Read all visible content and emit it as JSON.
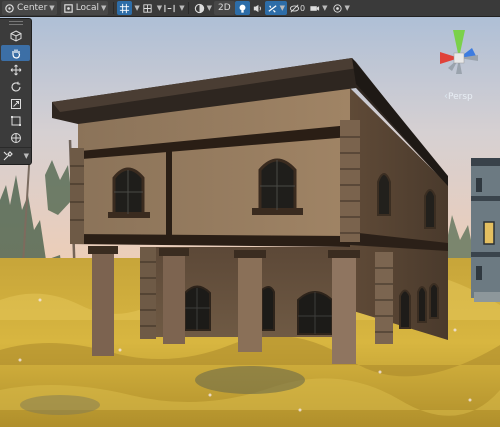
{
  "toolbar": {
    "pivot_label": "Center",
    "space_label": "Local",
    "mode_2d_label": "2D"
  },
  "gizmo": {
    "projection_label": "Persp"
  },
  "icons": {
    "pivot": "pivot-icon",
    "space": "local-space-icon",
    "grid": "grid-icon",
    "snap": "snap-icon",
    "draw_mode": "shading-icon",
    "lighting": "lightbulb-icon",
    "audio": "audio-icon",
    "effects": "effects-icon",
    "visibility": "visibility-icon",
    "camera": "camera-icon",
    "gizmos": "gizmos-icon",
    "view_tool": "hand-icon",
    "move_tool": "move-icon",
    "rotate_tool": "rotate-icon",
    "scale_tool": "scale-icon",
    "rect_tool": "rect-icon",
    "transform_tool": "transform-icon",
    "custom_tool": "tools-icon"
  },
  "colors": {
    "toolbar_bg": "#3a3a3a",
    "active_blue": "#2d6da8",
    "axis_x": "#e0423a",
    "axis_y": "#7bd14a",
    "axis_z": "#3d7ce0",
    "sky_top": "#b9cbe0",
    "sky_horizon": "#e8cdb5",
    "grass": "#c9a832"
  }
}
